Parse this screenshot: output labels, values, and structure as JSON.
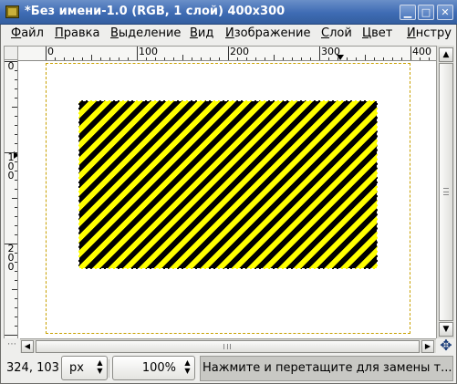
{
  "window": {
    "title": "*Без имени-1.0 (RGB, 1 слой) 400x300",
    "minimize_glyph": "▁",
    "maximize_glyph": "□",
    "close_glyph": "✕"
  },
  "menu": [
    {
      "pre": "",
      "u": "Ф",
      "post": "айл"
    },
    {
      "pre": "",
      "u": "П",
      "post": "равка"
    },
    {
      "pre": "",
      "u": "В",
      "post": "ыделение"
    },
    {
      "pre": "",
      "u": "В",
      "post": "ид"
    },
    {
      "pre": "",
      "u": "И",
      "post": "зображение"
    },
    {
      "pre": "",
      "u": "С",
      "post": "лой"
    },
    {
      "pre": "",
      "u": "Ц",
      "post": "вет"
    },
    {
      "pre": "",
      "u": "И",
      "post": "нстру"
    }
  ],
  "rulers": {
    "horizontal_labels": [
      "0",
      "100",
      "200",
      "300",
      "400"
    ],
    "vertical_labels": [
      [
        "0"
      ],
      [
        "1",
        "0",
        "0"
      ],
      [
        "2",
        "0",
        "0"
      ]
    ]
  },
  "canvas": {
    "pattern_colors": [
      "#ffff00",
      "#000000"
    ],
    "boundary_color": "#c8a000"
  },
  "status": {
    "coordinates": "324, 103",
    "unit": "px",
    "zoom": "100%",
    "message": "Нажмите и перетащите для замены т..."
  },
  "icons": {
    "spin_up": "▲",
    "spin_down": "▼",
    "arrow_up": "▲",
    "arrow_down": "▼",
    "arrow_left": "◀",
    "arrow_right": "▶",
    "navigate": "✥",
    "quickmask": "⋯"
  }
}
